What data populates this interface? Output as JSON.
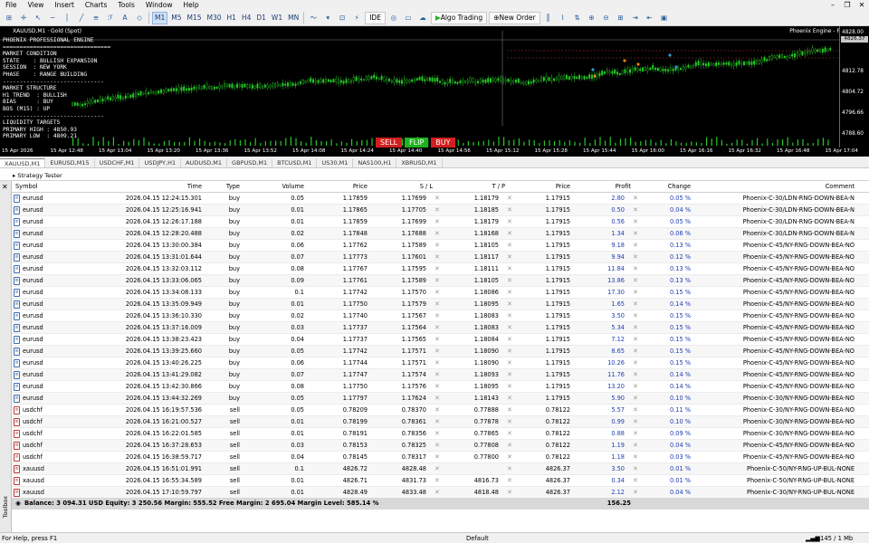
{
  "menu": [
    "File",
    "View",
    "Insert",
    "Charts",
    "Tools",
    "Window",
    "Help"
  ],
  "toolbar": {
    "timeframes": [
      "M1",
      "M5",
      "M15",
      "M30",
      "H1",
      "H4",
      "D1",
      "W1",
      "MN"
    ],
    "active_tf": "M1",
    "ide": "IDE",
    "algo": "Algo Trading",
    "new_order": "New Order"
  },
  "chart": {
    "title": "XAUUSD,M1 · Gold (Spot)",
    "tag": "Phoenix Engine - Pro",
    "panel": [
      "PHOENIX PROFESSIONAL ENGINE",
      "================================",
      "MARKET CONDITION",
      "STATE    : BULLISH EXPANSION",
      "SESSION  : NEW YORK",
      "PHASE    : RANGE BUILDING",
      "------------------------------",
      "MARKET STRUCTURE",
      "H1 TREND  : BULLISH",
      "BIAS      : BUY",
      "BOS (M15) : UP",
      "------------------------------",
      "LIQUIDITY TARGETS",
      "PRIMARY HIGH : 4850.93",
      "PRIMARY LOW  : 4809.21"
    ],
    "prices": [
      "4828.00",
      "4826.37",
      "4820.36",
      "4812.78",
      "4804.72",
      "4796.66",
      "4788.60"
    ],
    "price_badge": "4826.37",
    "buttons": {
      "sell": "SELL",
      "flip": "FLIP",
      "buy": "BUY"
    },
    "colors": {
      "sell": "#d21e1e",
      "flip": "#1eb41e",
      "buy": "#d21e1e",
      "candle": "#26c826"
    },
    "times": [
      "15 Apr 2026",
      "15 Apr 12:48",
      "15 Apr 13:04",
      "15 Apr 13:20",
      "15 Apr 13:36",
      "15 Apr 13:52",
      "15 Apr 14:08",
      "15 Apr 14:24",
      "15 Apr 14:40",
      "15 Apr 14:56",
      "15 Apr 15:12",
      "15 Apr 15:28",
      "15 Apr 15:44",
      "15 Apr 16:00",
      "15 Apr 16:16",
      "15 Apr 16:32",
      "15 Apr 16:48",
      "15 Apr 17:04"
    ]
  },
  "symbol_tabs": [
    "XAUUSD,M1",
    "EURUSD,M15",
    "USDCHF,M1",
    "USDJPY,H1",
    "AUDUSD,M1",
    "GBPUSD,M1",
    "BTCUSD,M1",
    "US30,M1",
    "NAS100,H1",
    "XBRUSD,M1"
  ],
  "strategy_tester": "Strategy Tester",
  "headers": {
    "symbol": "Symbol",
    "time": "Time",
    "type": "Type",
    "volume": "Volume",
    "price": "Price",
    "sl": "S / L",
    "tp": "T / P",
    "cur": "Price",
    "profit": "Profit",
    "change": "Change",
    "comment": "Comment"
  },
  "rows": [
    [
      "eurusd",
      "2026.04.15 12:24:15.301",
      "buy",
      "0.05",
      "1.17859",
      "1.17699",
      "1.18179",
      "1.17915",
      "2.80",
      "0.05 %",
      "Phoenix-C-30/LDN-RNG-DOWN-BEA-N"
    ],
    [
      "eurusd",
      "2026.04.15 12:25:16.941",
      "buy",
      "0.01",
      "1.17865",
      "1.17705",
      "1.18185",
      "1.17915",
      "0.50",
      "0.04 %",
      "Phoenix-C-30/LDN-RNG-DOWN-BEA-N"
    ],
    [
      "eurusd",
      "2026.04.15 12:26:17.188",
      "buy",
      "0.01",
      "1.17859",
      "1.17699",
      "1.18179",
      "1.17915",
      "0.56",
      "0.05 %",
      "Phoenix-C-30/LDN-RNG-DOWN-BEA-N"
    ],
    [
      "eurusd",
      "2026.04.15 12:28:20.488",
      "buy",
      "0.02",
      "1.17848",
      "1.17688",
      "1.18168",
      "1.17915",
      "1.34",
      "0.06 %",
      "Phoenix-C-30/LDN-RNG-DOWN-BEA-N"
    ],
    [
      "eurusd",
      "2026.04.15 13:30:00.384",
      "buy",
      "0.06",
      "1.17762",
      "1.17589",
      "1.18105",
      "1.17915",
      "9.18",
      "0.13 %",
      "Phoenix-C-45/NY-RNG-DOWN-BEA-NO"
    ],
    [
      "eurusd",
      "2026.04.15 13:31:01.644",
      "buy",
      "0.07",
      "1.17773",
      "1.17601",
      "1.18117",
      "1.17915",
      "9.94",
      "0.12 %",
      "Phoenix-C-45/NY-RNG-DOWN-BEA-NO"
    ],
    [
      "eurusd",
      "2026.04.15 13:32:03.112",
      "buy",
      "0.08",
      "1.17767",
      "1.17595",
      "1.18111",
      "1.17915",
      "11.84",
      "0.13 %",
      "Phoenix-C-45/NY-RNG-DOWN-BEA-NO"
    ],
    [
      "eurusd",
      "2026.04.15 13:33:06.065",
      "buy",
      "0.09",
      "1.17761",
      "1.17589",
      "1.18105",
      "1.17915",
      "13.86",
      "0.13 %",
      "Phoenix-C-45/NY-RNG-DOWN-BEA-NO"
    ],
    [
      "eurusd",
      "2026.04.15 13:34:08.133",
      "buy",
      "0.1",
      "1.17742",
      "1.17570",
      "1.18086",
      "1.17915",
      "17.30",
      "0.15 %",
      "Phoenix-C-45/NY-RNG-DOWN-BEA-NO"
    ],
    [
      "eurusd",
      "2026.04.15 13:35:09.949",
      "buy",
      "0.01",
      "1.17750",
      "1.17579",
      "1.18095",
      "1.17915",
      "1.65",
      "0.14 %",
      "Phoenix-C-45/NY-RNG-DOWN-BEA-NO"
    ],
    [
      "eurusd",
      "2026.04.15 13:36:10.330",
      "buy",
      "0.02",
      "1.17740",
      "1.17567",
      "1.18083",
      "1.17915",
      "3.50",
      "0.15 %",
      "Phoenix-C-45/NY-RNG-DOWN-BEA-NO"
    ],
    [
      "eurusd",
      "2026.04.15 13:37:16.009",
      "buy",
      "0.03",
      "1.17737",
      "1.17564",
      "1.18083",
      "1.17915",
      "5.34",
      "0.15 %",
      "Phoenix-C-45/NY-RNG-DOWN-BEA-NO"
    ],
    [
      "eurusd",
      "2026.04.15 13:38:23.423",
      "buy",
      "0.04",
      "1.17737",
      "1.17565",
      "1.18084",
      "1.17915",
      "7.12",
      "0.15 %",
      "Phoenix-C-45/NY-RNG-DOWN-BEA-NO"
    ],
    [
      "eurusd",
      "2026.04.15 13:39:25.660",
      "buy",
      "0.05",
      "1.17742",
      "1.17571",
      "1.18090",
      "1.17915",
      "8.65",
      "0.15 %",
      "Phoenix-C-45/NY-RNG-DOWN-BEA-NO"
    ],
    [
      "eurusd",
      "2026.04.15 13:40:26.225",
      "buy",
      "0.06",
      "1.17744",
      "1.17571",
      "1.18090",
      "1.17915",
      "10.26",
      "0.15 %",
      "Phoenix-C-45/NY-RNG-DOWN-BEA-NO"
    ],
    [
      "eurusd",
      "2026.04.15 13:41:29.082",
      "buy",
      "0.07",
      "1.17747",
      "1.17574",
      "1.18093",
      "1.17915",
      "11.76",
      "0.14 %",
      "Phoenix-C-45/NY-RNG-DOWN-BEA-NO"
    ],
    [
      "eurusd",
      "2026.04.15 13:42:30.866",
      "buy",
      "0.08",
      "1.17750",
      "1.17576",
      "1.18095",
      "1.17915",
      "13.20",
      "0.14 %",
      "Phoenix-C-45/NY-RNG-DOWN-BEA-NO"
    ],
    [
      "eurusd",
      "2026.04.15 13:44:32.269",
      "buy",
      "0.05",
      "1.17797",
      "1.17624",
      "1.18143",
      "1.17915",
      "5.90",
      "0.10 %",
      "Phoenix-C-30/NY-RNG-DOWN-BEA-NO"
    ],
    [
      "usdchf",
      "2026.04.15 16:19:57.536",
      "sell",
      "0.05",
      "0.78209",
      "0.78370",
      "0.77888",
      "0.78122",
      "5.57",
      "0.11 %",
      "Phoenix-C-30/NY-RNG-DOWN-BEA-NO"
    ],
    [
      "usdchf",
      "2026.04.15 16:21:00.527",
      "sell",
      "0.01",
      "0.78199",
      "0.78361",
      "0.77878",
      "0.78122",
      "0.99",
      "0.10 %",
      "Phoenix-C-30/NY-RNG-DOWN-BEA-NO"
    ],
    [
      "usdchf",
      "2026.04.15 16:22:01.585",
      "sell",
      "0.01",
      "0.78191",
      "0.78356",
      "0.77865",
      "0.78122",
      "0.88",
      "0.09 %",
      "Phoenix-C-30/NY-RNG-DOWN-BEA-NO"
    ],
    [
      "usdchf",
      "2026.04.15 16:37:28.653",
      "sell",
      "0.03",
      "0.78153",
      "0.78325",
      "0.77808",
      "0.78122",
      "1.19",
      "0.04 %",
      "Phoenix-C-45/NY-RNG-DOWN-BEA-NO"
    ],
    [
      "usdchf",
      "2026.04.15 16:38:59.717",
      "sell",
      "0.04",
      "0.78145",
      "0.78317",
      "0.77800",
      "0.78122",
      "1.18",
      "0.03 %",
      "Phoenix-C-45/NY-RNG-DOWN-BEA-NO"
    ],
    [
      "xauusd",
      "2026.04.15 16:51:01.991",
      "sell",
      "0.1",
      "4826.72",
      "4828.48",
      "",
      "4826.37",
      "3.50",
      "0.01 %",
      "Phoenix-C-50/NY-RNG-UP-BUL-NONE"
    ],
    [
      "xauusd",
      "2026.04.15 16:55:34.589",
      "sell",
      "0.01",
      "4826.71",
      "4831.73",
      "4816.73",
      "4826.37",
      "0.34",
      "0.01 %",
      "Phoenix-C-50/NY-RNG-UP-BUL-NONE"
    ],
    [
      "xauusd",
      "2026.04.15 17:10:59.797",
      "sell",
      "0.01",
      "4828.49",
      "4833.48",
      "4818.48",
      "4826.37",
      "2.12",
      "0.04 %",
      "Phoenix-C-30/NY-RNG-UP-BUL-NONE"
    ]
  ],
  "summary": {
    "text": "Balance: 3 094.31 USD  Equity: 3 250.56  Margin: 555.52  Free Margin: 2 695.04  Margin Level: 585.14 %",
    "total": "156.25"
  },
  "status": {
    "help": "For Help, press F1",
    "profile": "Default",
    "traffic": "145 / 1 Mb"
  },
  "toolbox_label": "Toolbox"
}
